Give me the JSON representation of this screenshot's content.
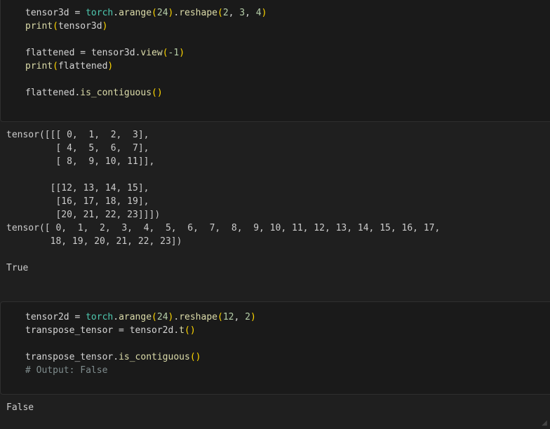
{
  "cells": [
    {
      "lines": [
        [
          {
            "t": "tensor3d",
            "c": "tk-var"
          },
          {
            "t": " = ",
            "c": "tk-op"
          },
          {
            "t": "torch",
            "c": "tk-mod"
          },
          {
            "t": ".",
            "c": "tk-op"
          },
          {
            "t": "arange",
            "c": "tk-fn"
          },
          {
            "t": "(",
            "c": "tk-paren"
          },
          {
            "t": "24",
            "c": "tk-num"
          },
          {
            "t": ")",
            "c": "tk-paren"
          },
          {
            "t": ".",
            "c": "tk-op"
          },
          {
            "t": "reshape",
            "c": "tk-fn"
          },
          {
            "t": "(",
            "c": "tk-paren"
          },
          {
            "t": "2",
            "c": "tk-num"
          },
          {
            "t": ", ",
            "c": "tk-op"
          },
          {
            "t": "3",
            "c": "tk-num"
          },
          {
            "t": ", ",
            "c": "tk-op"
          },
          {
            "t": "4",
            "c": "tk-num"
          },
          {
            "t": ")",
            "c": "tk-paren"
          }
        ],
        [
          {
            "t": "print",
            "c": "tk-fn"
          },
          {
            "t": "(",
            "c": "tk-paren"
          },
          {
            "t": "tensor3d",
            "c": "tk-var"
          },
          {
            "t": ")",
            "c": "tk-paren"
          }
        ],
        [],
        [
          {
            "t": "flattened",
            "c": "tk-var"
          },
          {
            "t": " = ",
            "c": "tk-op"
          },
          {
            "t": "tensor3d",
            "c": "tk-var"
          },
          {
            "t": ".",
            "c": "tk-op"
          },
          {
            "t": "view",
            "c": "tk-fn"
          },
          {
            "t": "(",
            "c": "tk-paren"
          },
          {
            "t": "-1",
            "c": "tk-num"
          },
          {
            "t": ")",
            "c": "tk-paren"
          }
        ],
        [
          {
            "t": "print",
            "c": "tk-fn"
          },
          {
            "t": "(",
            "c": "tk-paren"
          },
          {
            "t": "flattened",
            "c": "tk-var"
          },
          {
            "t": ")",
            "c": "tk-paren"
          }
        ],
        [],
        [
          {
            "t": "flattened",
            "c": "tk-var"
          },
          {
            "t": ".",
            "c": "tk-op"
          },
          {
            "t": "is_contiguous",
            "c": "tk-fn"
          },
          {
            "t": "()",
            "c": "tk-paren"
          }
        ]
      ],
      "output": [
        "tensor([[[ 0,  1,  2,  3],",
        "         [ 4,  5,  6,  7],",
        "         [ 8,  9, 10, 11]],",
        "",
        "        [[12, 13, 14, 15],",
        "         [16, 17, 18, 19],",
        "         [20, 21, 22, 23]]])",
        "tensor([ 0,  1,  2,  3,  4,  5,  6,  7,  8,  9, 10, 11, 12, 13, 14, 15, 16, 17,",
        "        18, 19, 20, 21, 22, 23])",
        "",
        "True"
      ]
    },
    {
      "lines": [
        [
          {
            "t": "tensor2d",
            "c": "tk-var"
          },
          {
            "t": " = ",
            "c": "tk-op"
          },
          {
            "t": "torch",
            "c": "tk-mod"
          },
          {
            "t": ".",
            "c": "tk-op"
          },
          {
            "t": "arange",
            "c": "tk-fn"
          },
          {
            "t": "(",
            "c": "tk-paren"
          },
          {
            "t": "24",
            "c": "tk-num"
          },
          {
            "t": ")",
            "c": "tk-paren"
          },
          {
            "t": ".",
            "c": "tk-op"
          },
          {
            "t": "reshape",
            "c": "tk-fn"
          },
          {
            "t": "(",
            "c": "tk-paren"
          },
          {
            "t": "12",
            "c": "tk-num"
          },
          {
            "t": ", ",
            "c": "tk-op"
          },
          {
            "t": "2",
            "c": "tk-num"
          },
          {
            "t": ")",
            "c": "tk-paren"
          }
        ],
        [
          {
            "t": "transpose_tensor",
            "c": "tk-var"
          },
          {
            "t": " = ",
            "c": "tk-op"
          },
          {
            "t": "tensor2d",
            "c": "tk-var"
          },
          {
            "t": ".",
            "c": "tk-op"
          },
          {
            "t": "t",
            "c": "tk-fn"
          },
          {
            "t": "()",
            "c": "tk-paren"
          }
        ],
        [],
        [
          {
            "t": "transpose_tensor",
            "c": "tk-var"
          },
          {
            "t": ".",
            "c": "tk-op"
          },
          {
            "t": "is_contiguous",
            "c": "tk-fn"
          },
          {
            "t": "()",
            "c": "tk-paren"
          }
        ],
        [
          {
            "t": "# Output: False",
            "c": "tk-comment"
          }
        ]
      ],
      "output": [
        "False"
      ]
    }
  ],
  "colors": {
    "background": "#1f1f1f",
    "cell_background": "#1a1a1a",
    "cell_border": "#2f2f2f",
    "identifier": "#d4d4d4",
    "module": "#4ec9b0",
    "function": "#dcdcaa",
    "number": "#b5cea8",
    "bracket": "#ffd700",
    "comment": "#7f8c8d",
    "output_text": "#cccccc"
  },
  "icons": {
    "resize_grip": "resize-grip-icon"
  }
}
